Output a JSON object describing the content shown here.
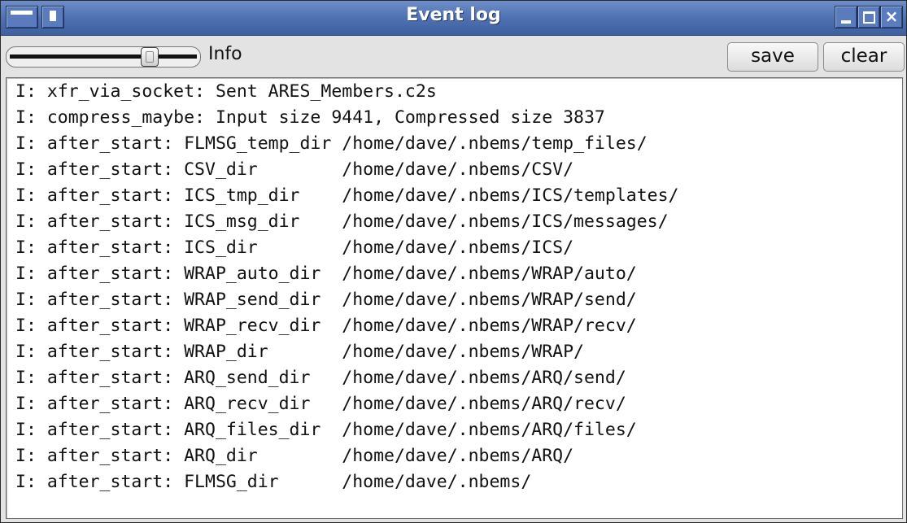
{
  "window": {
    "title": "Event log",
    "close_glyph": "×"
  },
  "toolbar": {
    "level_label": "Info",
    "save_label": "save",
    "clear_label": "clear"
  },
  "log": {
    "lines": [
      "I: xfr_via_socket: Sent ARES_Members.c2s",
      "I: compress_maybe: Input size 9441, Compressed size 3837",
      "I: after_start: FLMSG_temp_dir /home/dave/.nbems/temp_files/",
      "I: after_start: CSV_dir        /home/dave/.nbems/CSV/",
      "I: after_start: ICS_tmp_dir    /home/dave/.nbems/ICS/templates/",
      "I: after_start: ICS_msg_dir    /home/dave/.nbems/ICS/messages/",
      "I: after_start: ICS_dir        /home/dave/.nbems/ICS/",
      "I: after_start: WRAP_auto_dir  /home/dave/.nbems/WRAP/auto/",
      "I: after_start: WRAP_send_dir  /home/dave/.nbems/WRAP/send/",
      "I: after_start: WRAP_recv_dir  /home/dave/.nbems/WRAP/recv/",
      "I: after_start: WRAP_dir       /home/dave/.nbems/WRAP/",
      "I: after_start: ARQ_send_dir   /home/dave/.nbems/ARQ/send/",
      "I: after_start: ARQ_recv_dir   /home/dave/.nbems/ARQ/recv/",
      "I: after_start: ARQ_files_dir  /home/dave/.nbems/ARQ/files/",
      "I: after_start: ARQ_dir        /home/dave/.nbems/ARQ/",
      "I: after_start: FLMSG_dir      /home/dave/.nbems/"
    ]
  }
}
